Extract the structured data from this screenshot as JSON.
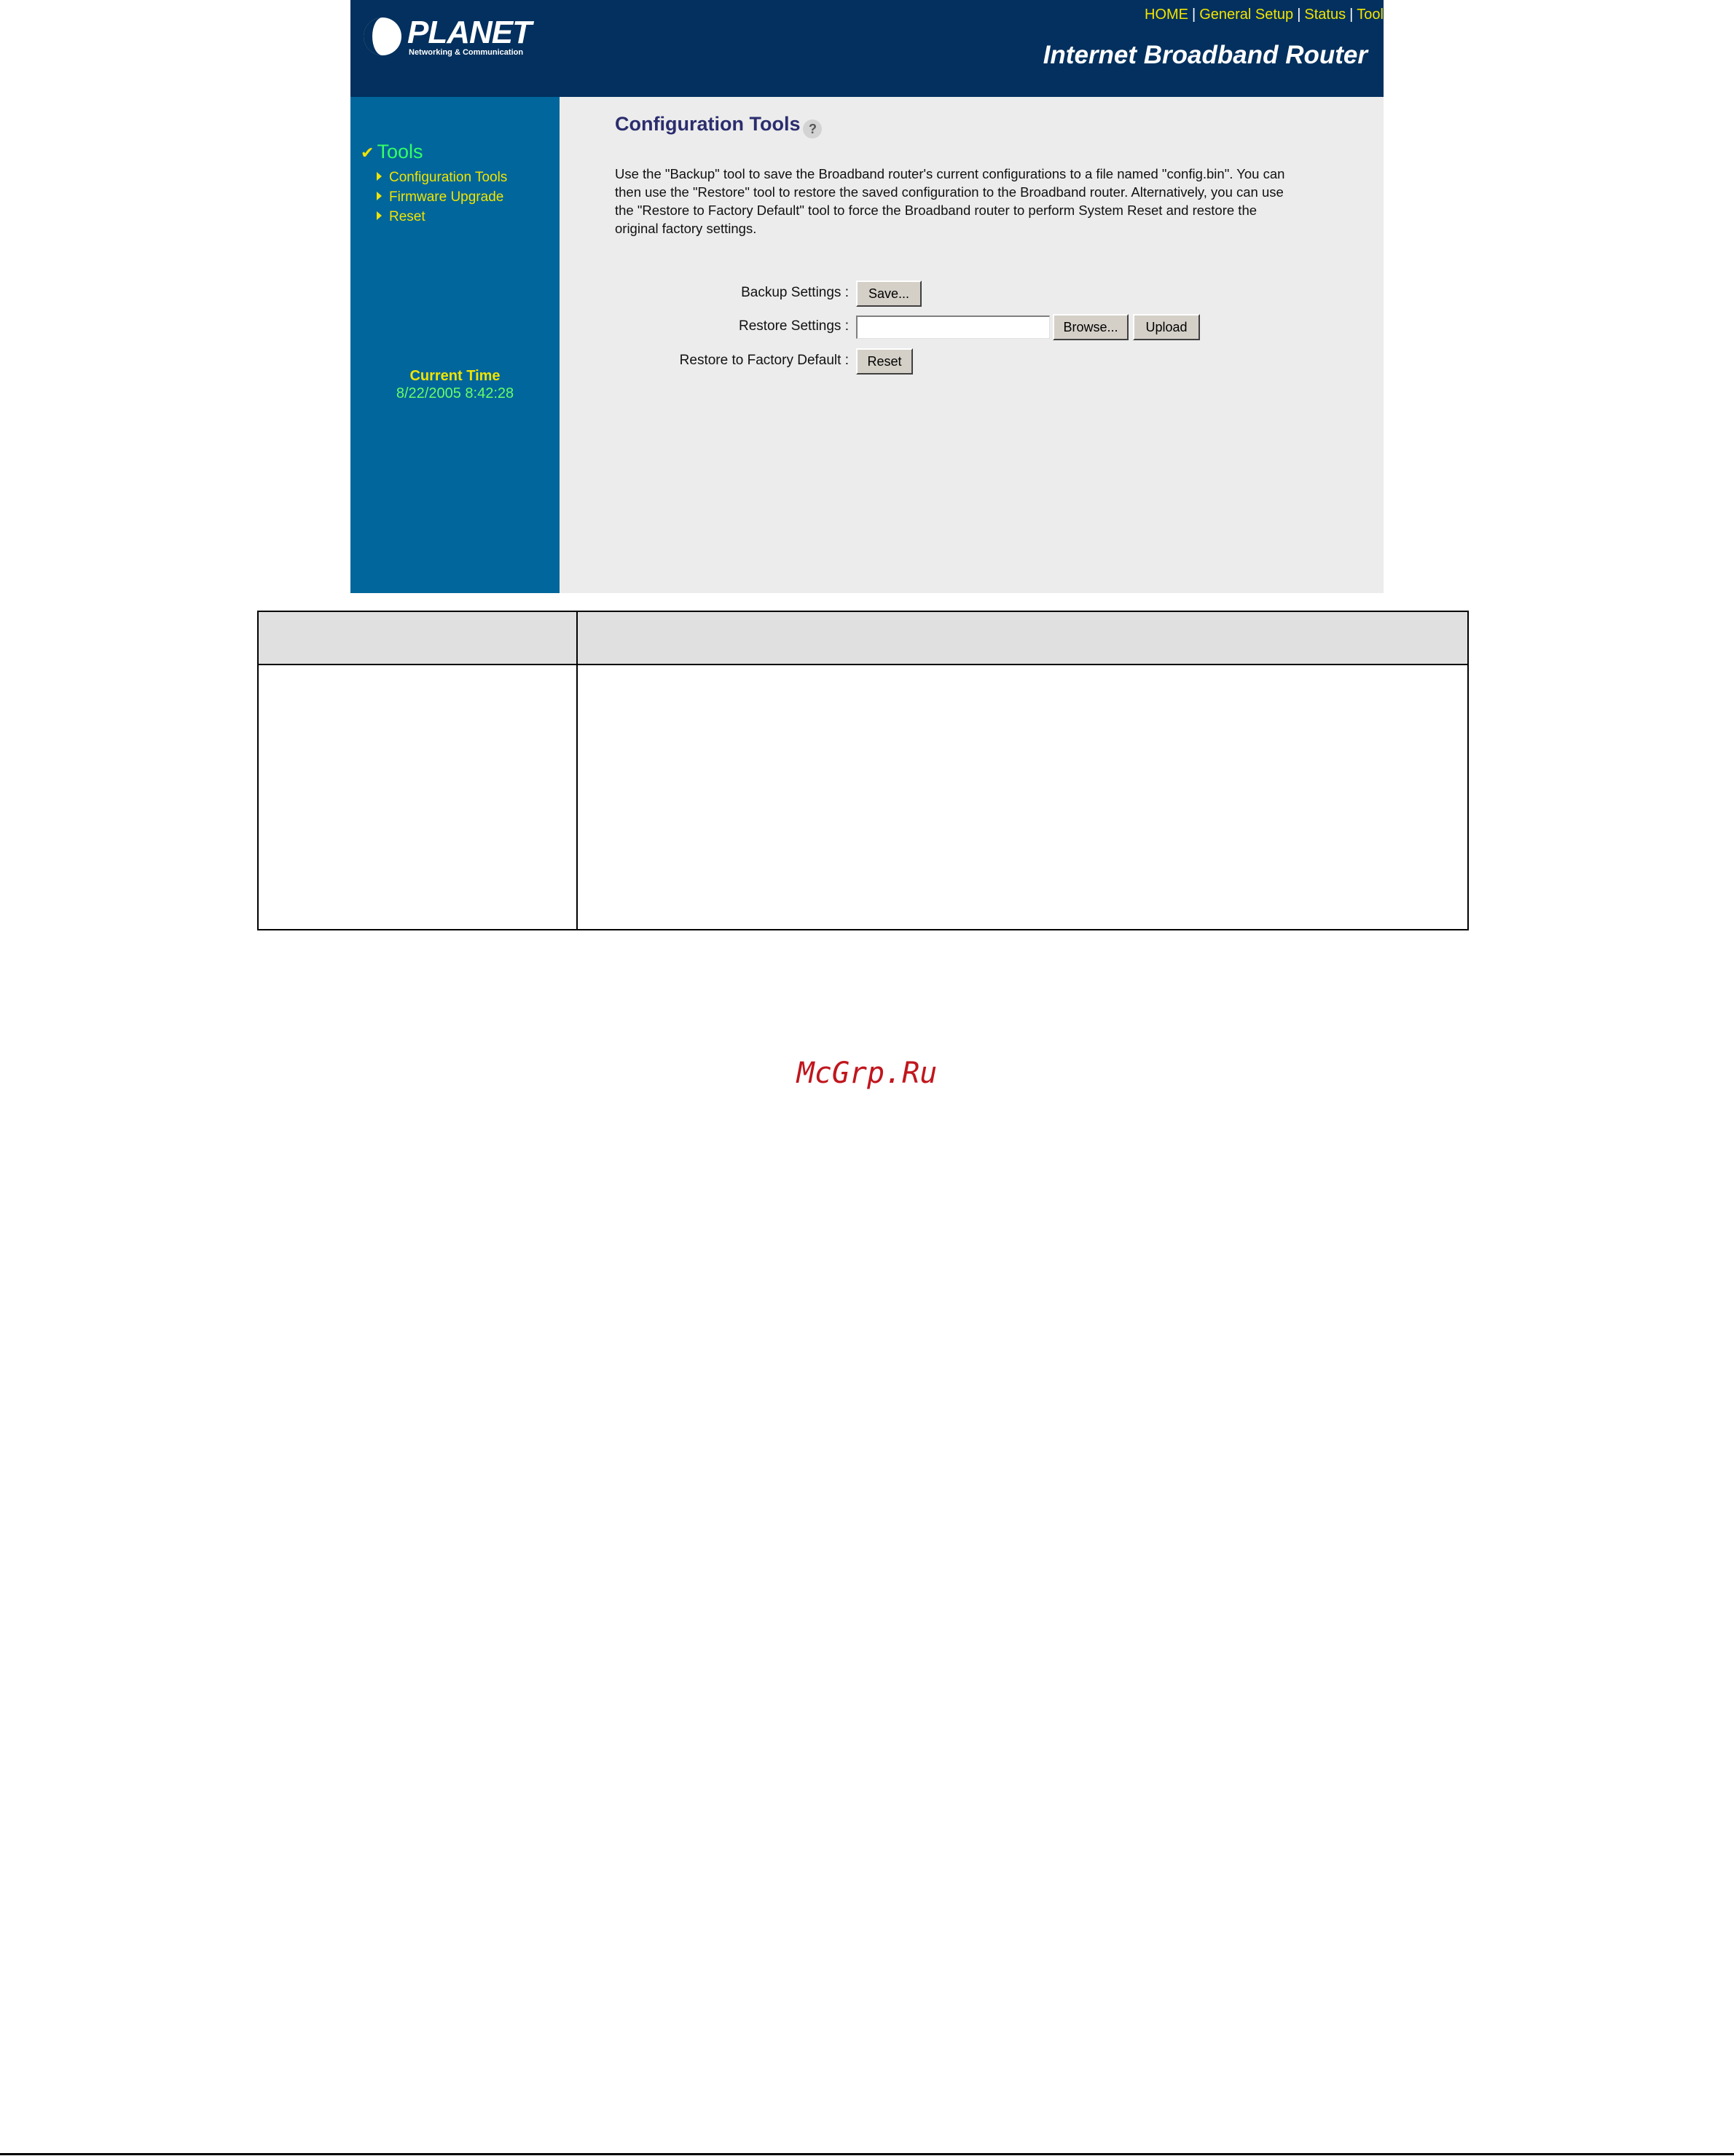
{
  "header": {
    "brand": "PLANET",
    "tagline": "Networking & Communication",
    "product_title": "Internet Broadband Router",
    "nav": [
      "HOME",
      "General Setup",
      "Status",
      "Tool"
    ]
  },
  "sidebar": {
    "section_title": "Tools",
    "items": [
      {
        "label": "Configuration Tools"
      },
      {
        "label": "Firmware Upgrade"
      },
      {
        "label": "Reset"
      }
    ],
    "current_time_label": "Current Time",
    "current_time_value": "8/22/2005 8:42:28"
  },
  "main": {
    "title": "Configuration Tools",
    "help_glyph": "?",
    "description": "Use the \"Backup\" tool to save the Broadband router's current configurations to a file named \"config.bin\". You can then use the \"Restore\" tool to restore the saved configuration to the Broadband router. Alternatively, you can use the \"Restore to Factory Default\" tool to force the Broadband router to perform System Reset and restore the original factory settings.",
    "backup": {
      "label": "Backup Settings :",
      "button": "Save..."
    },
    "restore": {
      "label": "Restore Settings :",
      "file_value": "",
      "browse_button": "Browse...",
      "upload_button": "Upload"
    },
    "factory": {
      "label": "Restore to Factory Default :",
      "button": "Reset"
    }
  },
  "watermark": "McGrp.Ru",
  "colors": {
    "header_bg": "#03305e",
    "sidebar_bg": "#00669b",
    "content_bg": "#ececec",
    "nav_link": "#f1e400",
    "section_title": "#33ff66",
    "page_title": "#2b2d6e",
    "watermark": "#c0161d"
  }
}
